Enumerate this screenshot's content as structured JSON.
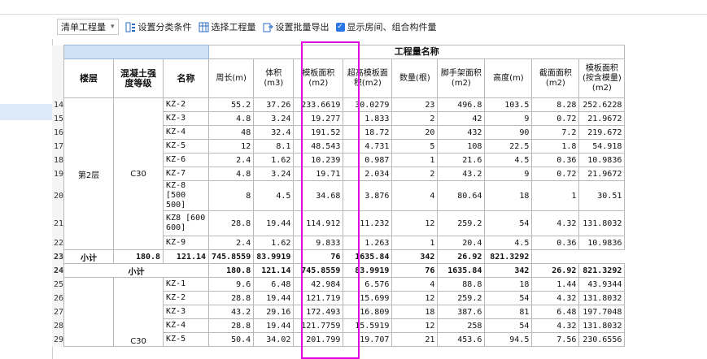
{
  "toolbar": {
    "dropdown_value": "清单工程量",
    "classify_label": "设置分类条件",
    "select_qty_label": "选择工程量",
    "batch_export_label": "设置批量导出",
    "show_rooms_label": "显示房间、组合构件量"
  },
  "table": {
    "group_header": "工程量名称",
    "columns": [
      "楼层",
      "混凝土强度等级",
      "名称",
      "周长(m)",
      "体积(m3)",
      "模板面积(m2)",
      "超高模板面积(m2)",
      "数量(根)",
      "脚手架面积(m2)",
      "高度(m)",
      "截面面积(m2)",
      "模板面积(按含模量)(m2)"
    ],
    "floor_label": "第2层",
    "grade_label": "C30",
    "grade_label_2": "C30",
    "subtotal_label": "小计",
    "floor_subtotal_label": "小计",
    "rows": [
      {
        "n": "14",
        "name": "KZ-2",
        "v": [
          "55.2",
          "37.26",
          "233.6619",
          "30.0279",
          "23",
          "496.8",
          "103.5",
          "8.28",
          "252.6228"
        ]
      },
      {
        "n": "15",
        "name": "KZ-3",
        "v": [
          "4.8",
          "3.24",
          "19.277",
          "1.833",
          "2",
          "42",
          "9",
          "0.72",
          "21.9672"
        ]
      },
      {
        "n": "16",
        "name": "KZ-4",
        "v": [
          "48",
          "32.4",
          "191.52",
          "18.72",
          "20",
          "432",
          "90",
          "7.2",
          "219.672"
        ]
      },
      {
        "n": "17",
        "name": "KZ-5",
        "v": [
          "12",
          "8.1",
          "48.543",
          "4.731",
          "5",
          "108",
          "22.5",
          "1.8",
          "54.918"
        ]
      },
      {
        "n": "18",
        "name": "KZ-6",
        "v": [
          "2.4",
          "1.62",
          "10.239",
          "0.987",
          "1",
          "21.6",
          "4.5",
          "0.36",
          "10.9836"
        ]
      },
      {
        "n": "19",
        "name": "KZ-7",
        "v": [
          "4.8",
          "3.24",
          "19.71",
          "2.034",
          "2",
          "43.2",
          "9",
          "0.72",
          "21.9672"
        ]
      },
      {
        "n": "20",
        "name": "KZ-8 [500 500]",
        "v": [
          "8",
          "4.5",
          "34.68",
          "3.876",
          "4",
          "80.64",
          "18",
          "1",
          "30.51"
        ]
      },
      {
        "n": "21",
        "name": "KZ8 [600 600]",
        "v": [
          "28.8",
          "19.44",
          "114.912",
          "11.232",
          "12",
          "259.2",
          "54",
          "4.32",
          "131.8032"
        ]
      },
      {
        "n": "22",
        "name": "KZ-9",
        "v": [
          "2.4",
          "1.62",
          "9.833",
          "1.263",
          "1",
          "20.4",
          "4.5",
          "0.36",
          "10.9836"
        ]
      }
    ],
    "subtotal_row": {
      "n": "23",
      "v": [
        "180.8",
        "121.14",
        "745.8559",
        "83.9919",
        "76",
        "1635.84",
        "342",
        "26.92",
        "821.3292"
      ]
    },
    "floor_subtotal_row": {
      "n": "24",
      "v": [
        "180.8",
        "121.14",
        "745.8559",
        "83.9919",
        "76",
        "1635.84",
        "342",
        "26.92",
        "821.3292"
      ]
    },
    "rows2": [
      {
        "n": "25",
        "name": "KZ-1",
        "v": [
          "9.6",
          "6.48",
          "42.984",
          "6.576",
          "4",
          "88.8",
          "18",
          "1.44",
          "43.9344"
        ]
      },
      {
        "n": "26",
        "name": "KZ-2",
        "v": [
          "28.8",
          "19.44",
          "121.719",
          "15.699",
          "12",
          "259.2",
          "54",
          "4.32",
          "131.8032"
        ]
      },
      {
        "n": "27",
        "name": "KZ-3",
        "v": [
          "43.2",
          "29.16",
          "172.493",
          "16.809",
          "18",
          "387.6",
          "81",
          "6.48",
          "197.7048"
        ]
      },
      {
        "n": "28",
        "name": "KZ-4",
        "v": [
          "28.8",
          "19.44",
          "121.7759",
          "15.5919",
          "12",
          "258",
          "54",
          "4.32",
          "131.8032"
        ]
      },
      {
        "n": "29",
        "name": "KZ-5",
        "v": [
          "50.4",
          "34.02",
          "201.799",
          "19.707",
          "21",
          "453.6",
          "94.5",
          "7.56",
          "230.6556"
        ]
      }
    ]
  }
}
